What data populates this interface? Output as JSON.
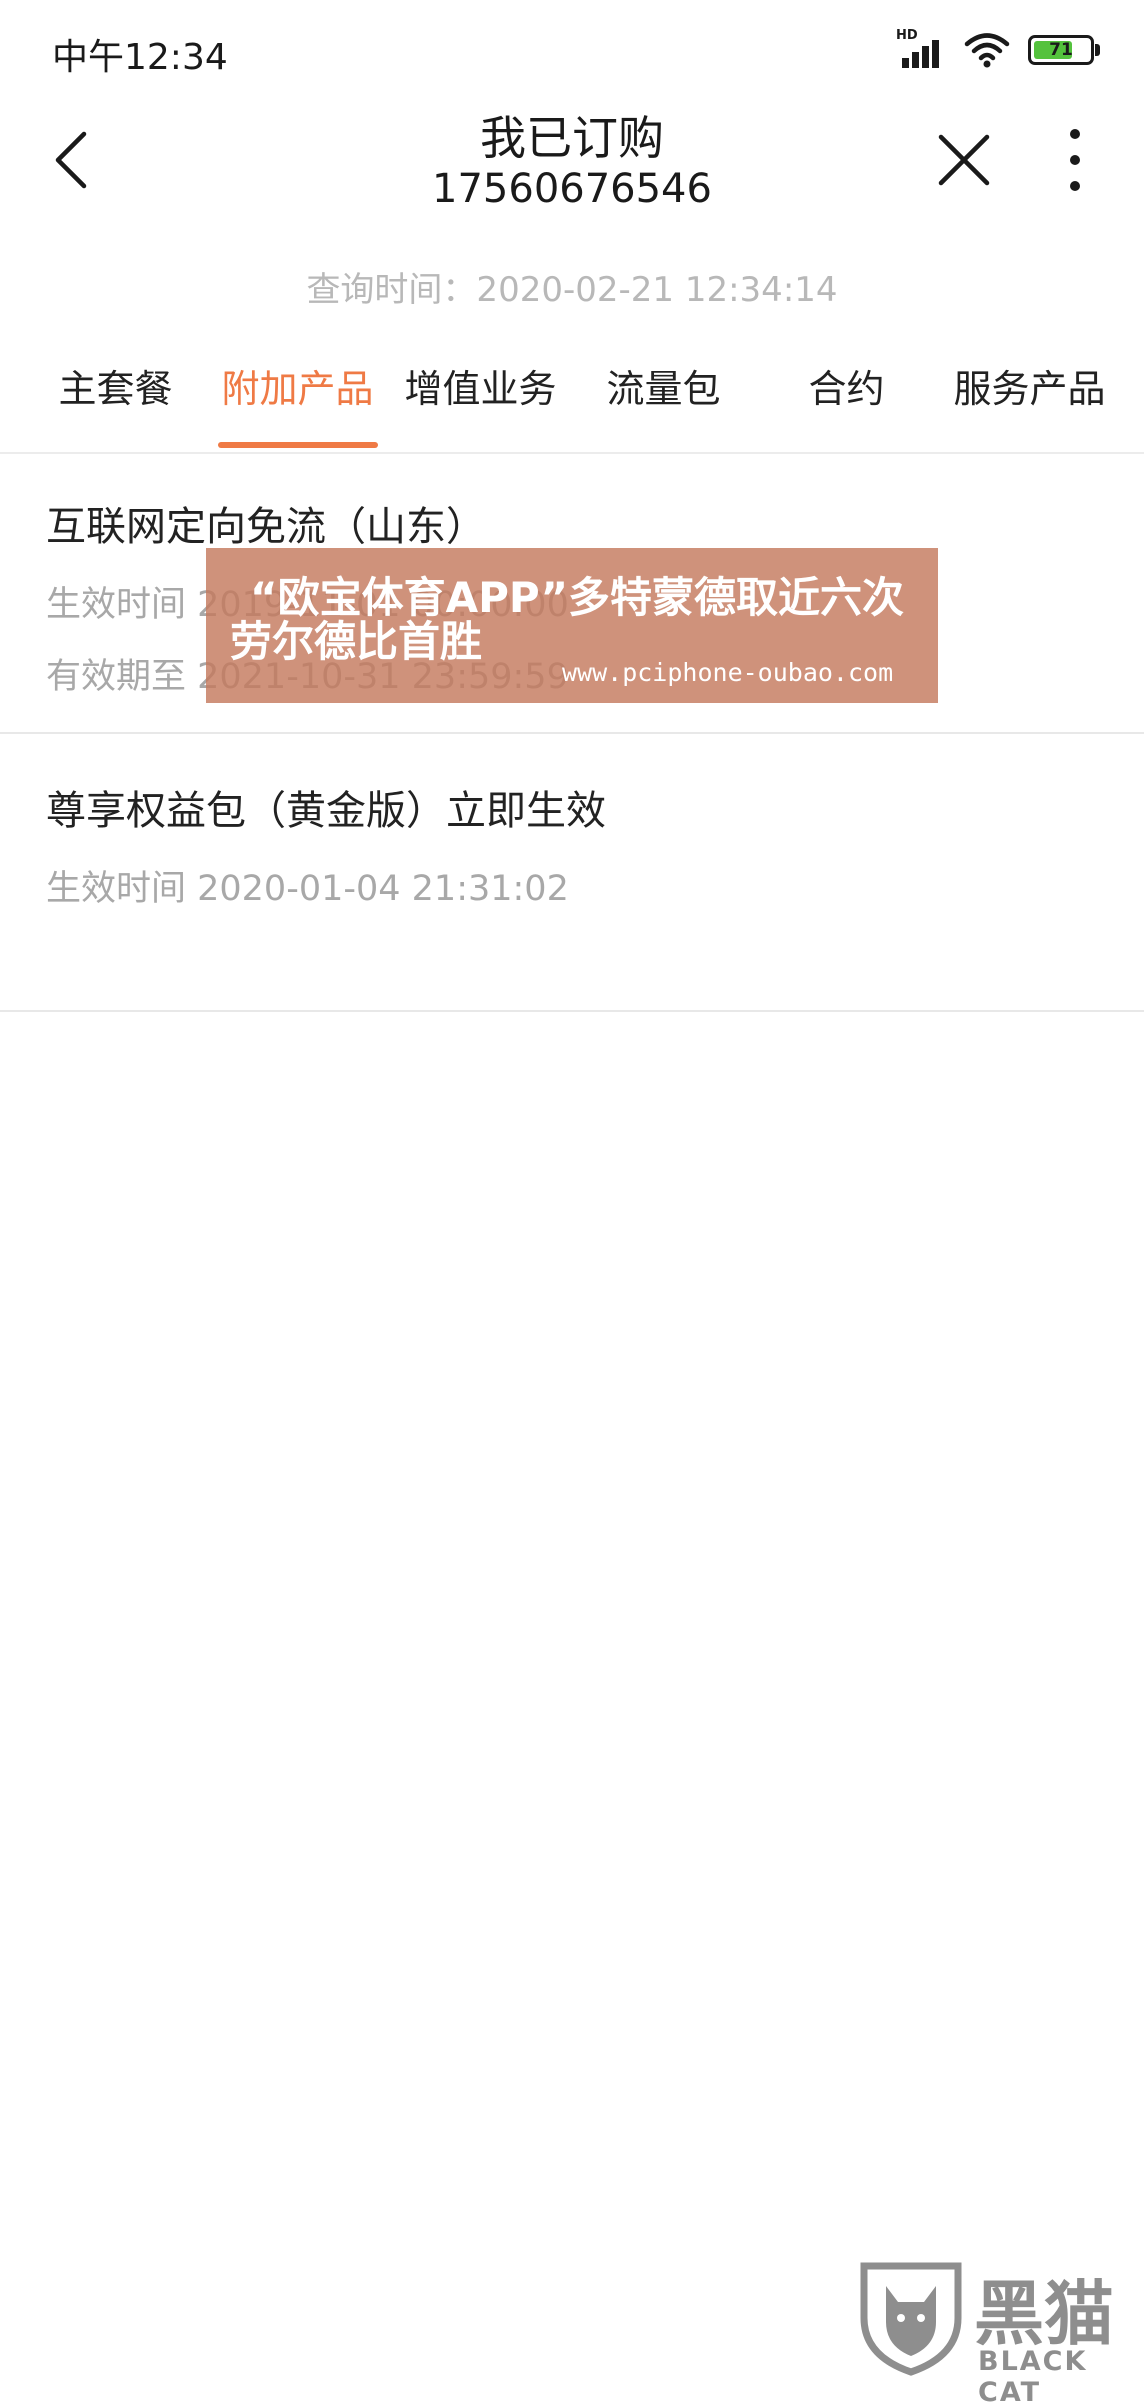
{
  "status_bar": {
    "time": "中午12:34",
    "network_label": "HD",
    "battery_level": "71",
    "battery_fraction": 0.71,
    "battery_color": "#54c23d"
  },
  "header": {
    "title": "我已订购",
    "subtitle": "17560676546",
    "back_icon": "chevron-left-icon",
    "close_icon": "close-icon",
    "more_icon": "more-vertical-icon"
  },
  "query_time": "查询时间：2020-02-21 12:34:14",
  "tabs": [
    {
      "label": "主套餐",
      "active": false
    },
    {
      "label": "附加产品",
      "active": true
    },
    {
      "label": "增值业务",
      "active": false
    },
    {
      "label": "流量包",
      "active": false
    },
    {
      "label": "合约",
      "active": false
    },
    {
      "label": "服务产品",
      "active": false
    }
  ],
  "accent_color": "#ef7a45",
  "items": [
    {
      "title": "互联网定向免流（山东）",
      "lines": [
        "生效时间 2019-11-01 00:00:00",
        "有效期至 2021-10-31 23:59:59"
      ]
    },
    {
      "title": "尊享权益包（黄金版）立即生效",
      "lines": [
        "生效时间 2020-01-04 21:31:02"
      ]
    }
  ],
  "overlay_ad": {
    "line1": "“欧宝体育APP”多特蒙德取近六次",
    "line2": "劳尔德比首胜",
    "url": "www.pciphone-oubao.com"
  },
  "watermark": {
    "cn": "黑猫",
    "en": "BLACK CAT",
    "icon": "cat-shield-icon"
  }
}
